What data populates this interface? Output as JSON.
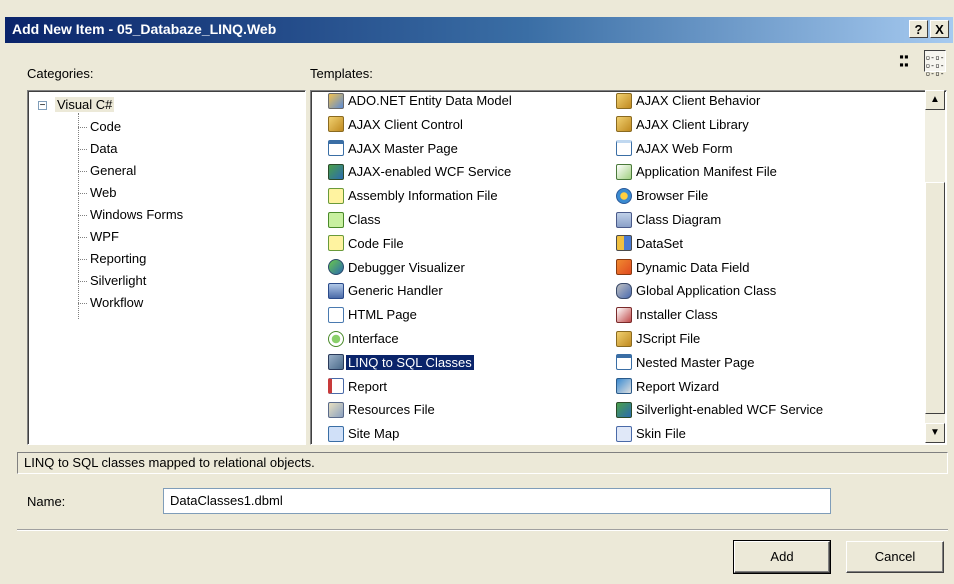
{
  "window": {
    "title": "Add New Item - 05_Databaze_LINQ.Web",
    "help_label": "?",
    "close_label": "X"
  },
  "categories": {
    "label": "Categories:",
    "root": "Visual C#",
    "root_toggle": "−",
    "items": [
      "Code",
      "Data",
      "General",
      "Web",
      "Windows Forms",
      "WPF",
      "Reporting",
      "Silverlight",
      "Workflow"
    ]
  },
  "templates": {
    "label": "Templates:",
    "view_large_icons": "▪▪\n▪▪",
    "view_small_icons": "▫-▫-\n▫-▫-",
    "column1": [
      {
        "label": "ADO.NET Entity Data Model",
        "icon": "entity-model-icon"
      },
      {
        "label": "AJAX Client Control",
        "icon": "script-icon"
      },
      {
        "label": "AJAX Master Page",
        "icon": "master-page-icon"
      },
      {
        "label": "AJAX-enabled WCF Service",
        "icon": "wcf-service-icon"
      },
      {
        "label": "Assembly Information File",
        "icon": "cs-file-icon"
      },
      {
        "label": "Class",
        "icon": "cs-class-icon"
      },
      {
        "label": "Code File",
        "icon": "cs-file-icon"
      },
      {
        "label": "Debugger Visualizer",
        "icon": "debugger-icon"
      },
      {
        "label": "Generic Handler",
        "icon": "handler-icon"
      },
      {
        "label": "HTML Page",
        "icon": "html-page-icon"
      },
      {
        "label": "Interface",
        "icon": "interface-icon"
      },
      {
        "label": "LINQ to SQL Classes",
        "icon": "linq-icon",
        "selected": true
      },
      {
        "label": "Report",
        "icon": "report-icon"
      },
      {
        "label": "Resources File",
        "icon": "resources-icon"
      },
      {
        "label": "Site Map",
        "icon": "sitemap-icon"
      }
    ],
    "column2": [
      {
        "label": "AJAX Client Behavior",
        "icon": "script-icon"
      },
      {
        "label": "AJAX Client Library",
        "icon": "script-icon"
      },
      {
        "label": "AJAX Web Form",
        "icon": "web-form-icon"
      },
      {
        "label": "Application Manifest File",
        "icon": "manifest-icon"
      },
      {
        "label": "Browser File",
        "icon": "browser-file-icon"
      },
      {
        "label": "Class Diagram",
        "icon": "class-diagram-icon"
      },
      {
        "label": "DataSet",
        "icon": "dataset-icon"
      },
      {
        "label": "Dynamic Data Field",
        "icon": "dynamic-data-icon"
      },
      {
        "label": "Global Application Class",
        "icon": "global-app-icon"
      },
      {
        "label": "Installer Class",
        "icon": "installer-icon"
      },
      {
        "label": "JScript File",
        "icon": "script-icon"
      },
      {
        "label": "Nested Master Page",
        "icon": "master-page-icon"
      },
      {
        "label": "Report Wizard",
        "icon": "report-wizard-icon"
      },
      {
        "label": "Silverlight-enabled WCF Service",
        "icon": "wcf-service-icon"
      },
      {
        "label": "Skin File",
        "icon": "skin-file-icon"
      }
    ],
    "scroll_up": "▲",
    "scroll_down": "▼"
  },
  "description": "LINQ to SQL classes mapped to relational objects.",
  "name_field": {
    "label": "Name:",
    "value": "DataClasses1.dbml"
  },
  "buttons": {
    "add": "Add",
    "cancel": "Cancel"
  },
  "colors": {
    "titlebar_start": "#0a246a",
    "selection": "#0a246a",
    "dialog_bg": "#ece9d8"
  }
}
